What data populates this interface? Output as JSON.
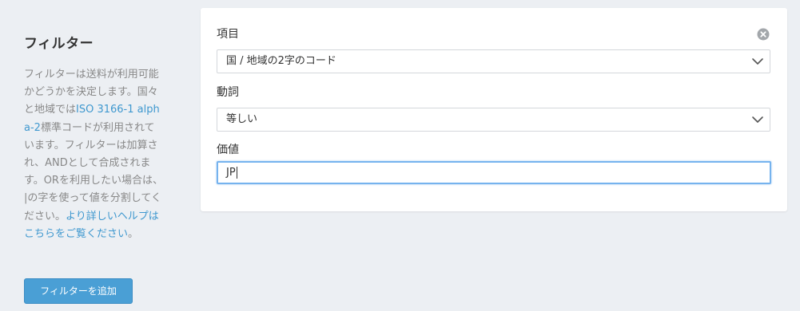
{
  "sidebar": {
    "title": "フィルター",
    "description_parts": {
      "p1": "フィルターは送料が利用可能かどうかを決定します。国々と地域では",
      "link1": "ISO 3166-1 alpha-2",
      "p2": "標準コードが利用されています。フィルターは加算され、ANDとして合成されます。ORを利用したい場合は、|の字を使って値を分割してください。",
      "link2": "より詳しいヘルプはこちらをご覧ください",
      "p3": "。"
    },
    "add_button_label": "フィルターを追加"
  },
  "filter_card": {
    "field_label": "項目",
    "field_value": "国 / 地域の2字のコード",
    "operator_label": "動詞",
    "operator_value": "等しい",
    "value_label": "価値",
    "value_input": "JP"
  },
  "colors": {
    "accent": "#4a9fd5",
    "link": "#3f98cf",
    "focus_border": "#76b3ee",
    "background": "#eceff3"
  },
  "icons": {
    "close": "close-circle-icon",
    "dropdown": "chevron-down-icon"
  }
}
